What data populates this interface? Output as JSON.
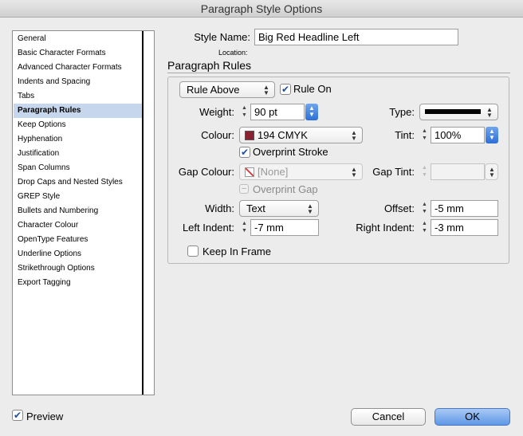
{
  "window": {
    "title": "Paragraph Style Options"
  },
  "sidebar": {
    "items": [
      {
        "label": "General"
      },
      {
        "label": "Basic Character Formats"
      },
      {
        "label": "Advanced Character Formats"
      },
      {
        "label": "Indents and Spacing"
      },
      {
        "label": "Tabs"
      },
      {
        "label": "Paragraph Rules",
        "selected": true
      },
      {
        "label": "Keep Options"
      },
      {
        "label": "Hyphenation"
      },
      {
        "label": "Justification"
      },
      {
        "label": "Span Columns"
      },
      {
        "label": "Drop Caps and Nested Styles"
      },
      {
        "label": "GREP Style"
      },
      {
        "label": "Bullets and Numbering"
      },
      {
        "label": "Character Colour"
      },
      {
        "label": "OpenType Features"
      },
      {
        "label": "Underline Options"
      },
      {
        "label": "Strikethrough Options"
      },
      {
        "label": "Export Tagging"
      }
    ]
  },
  "header": {
    "style_name_label": "Style Name:",
    "style_name_value": "Big Red Headline Left",
    "location_label": "Location:",
    "section_title": "Paragraph Rules"
  },
  "rules": {
    "rule_select": "Rule Above",
    "rule_on_label": "Rule On",
    "rule_on_checked": true,
    "weight_label": "Weight:",
    "weight_value": "90 pt",
    "type_label": "Type:",
    "colour_label": "Colour:",
    "colour_value": "194 CMYK",
    "colour_swatch": "#8b2232",
    "tint_label": "Tint:",
    "tint_value": "100%",
    "overprint_stroke_label": "Overprint Stroke",
    "overprint_stroke_checked": true,
    "gap_colour_label": "Gap Colour:",
    "gap_colour_value": "[None]",
    "gap_tint_label": "Gap Tint:",
    "overprint_gap_label": "Overprint Gap",
    "width_label": "Width:",
    "width_value": "Text",
    "offset_label": "Offset:",
    "offset_value": "-5 mm",
    "left_indent_label": "Left Indent:",
    "left_indent_value": "-7 mm",
    "right_indent_label": "Right Indent:",
    "right_indent_value": "-3 mm",
    "keep_in_frame_label": "Keep In Frame",
    "keep_in_frame_checked": false
  },
  "footer": {
    "preview_label": "Preview",
    "preview_checked": true,
    "cancel_label": "Cancel",
    "ok_label": "OK"
  }
}
